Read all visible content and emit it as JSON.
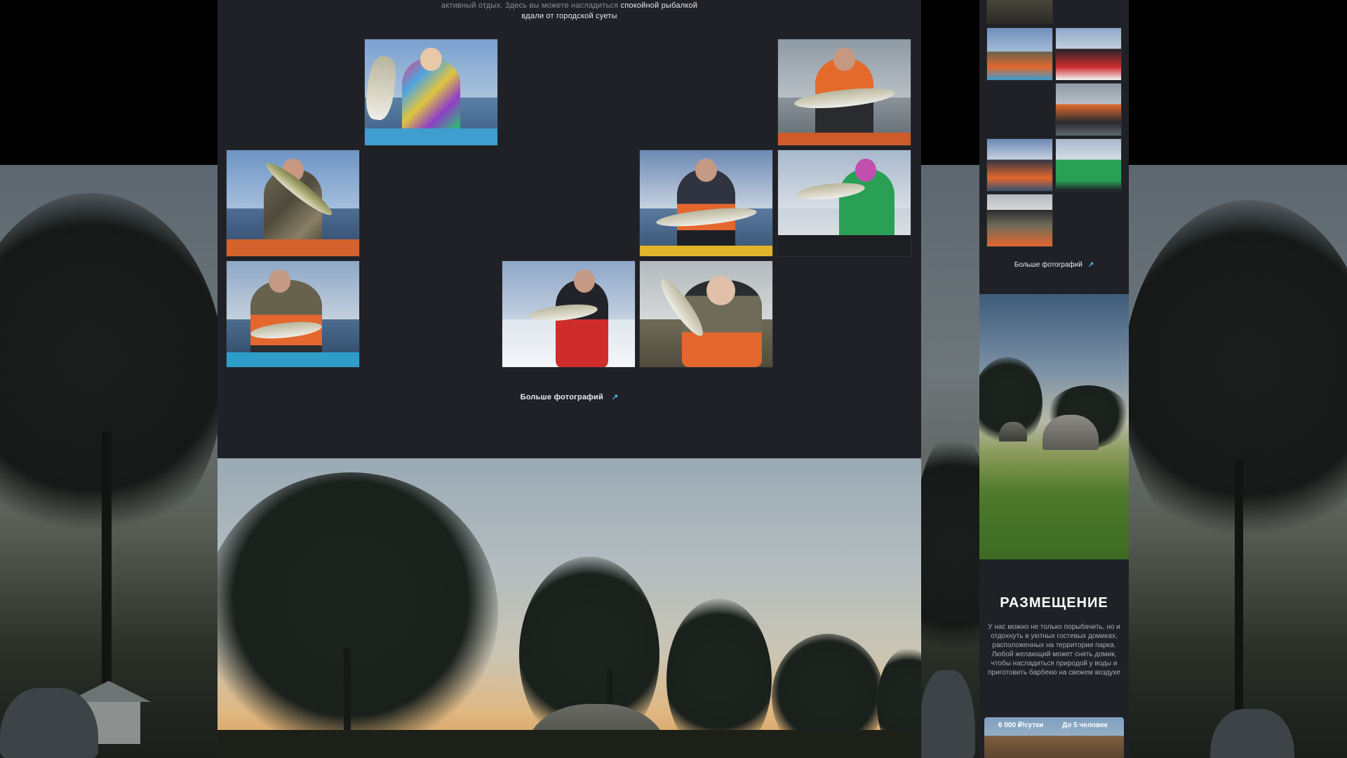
{
  "intro": {
    "line1_muted": "активный отдых. Здесь вы можете насладиться",
    "line1_bright": "спокойной рыбалкой",
    "line2": "вдали от городской суеты"
  },
  "gallery": {
    "more_label": "Больше фотографий",
    "photos": [
      {
        "name": "woman-pink-glasses-fish"
      },
      {
        "name": "man-yellow-glasses-zander"
      },
      {
        "name": "man-camo-pike"
      },
      {
        "name": "man-cap-zander-boat"
      },
      {
        "name": "person-green-hoodie-zander"
      },
      {
        "name": "man-cap-fish-boat"
      },
      {
        "name": "person-ice-zander"
      },
      {
        "name": "woman-cap-pike"
      }
    ]
  },
  "sidebar": {
    "more_label": "Больше фотографий",
    "title": "РАЗМЕЩЕНИЕ",
    "text": "У нас можно не только порыбачить, но и отдохнуть в уютных гостевых домиках, расположенных на территории парка. Любой желающий может снять домик, чтобы насладиться природой у воды и приготовить барбекю на свежем воздухе",
    "card": {
      "price": "6 000 ₽/сутки",
      "capacity": "До 5 человек"
    }
  },
  "icons": {
    "more_arrow": "arrow-up-right-icon"
  },
  "colors": {
    "page_bg": "#202126",
    "accent_arrow": "#4fb8ff",
    "text_main": "#e9e9ec",
    "text_muted": "#8b8d93"
  }
}
